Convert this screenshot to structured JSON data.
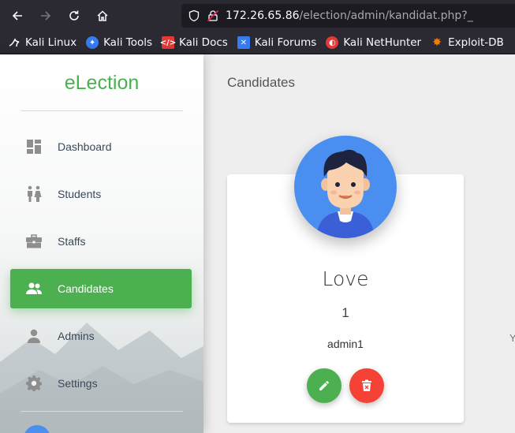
{
  "browser": {
    "url_host": "172.26.65.86",
    "url_path": "/election/admin/kandidat.php?_",
    "bookmarks": [
      {
        "label": "Kali Linux",
        "icon": "kali-dragon-icon",
        "color": "#ffffff"
      },
      {
        "label": "Kali Tools",
        "icon": "kali-tools-icon",
        "color": "#367bf0"
      },
      {
        "label": "Kali Docs",
        "icon": "kali-docs-icon",
        "color": "#e53935"
      },
      {
        "label": "Kali Forums",
        "icon": "kali-forums-icon",
        "color": "#367bf0"
      },
      {
        "label": "Kali NetHunter",
        "icon": "kali-nethunter-icon",
        "color": "#e53935"
      },
      {
        "label": "Exploit-DB",
        "icon": "exploit-db-icon",
        "color": "#f57c00"
      }
    ]
  },
  "sidebar": {
    "brand": "eLection",
    "items": [
      {
        "label": "Dashboard",
        "icon": "dashboard-icon",
        "active": false
      },
      {
        "label": "Students",
        "icon": "students-icon",
        "active": false
      },
      {
        "label": "Staffs",
        "icon": "briefcase-icon",
        "active": false
      },
      {
        "label": "Candidates",
        "icon": "people-icon",
        "active": true
      },
      {
        "label": "Admins",
        "icon": "person-icon",
        "active": false
      },
      {
        "label": "Settings",
        "icon": "gear-icon",
        "active": false
      }
    ]
  },
  "main": {
    "title": "Candidates",
    "edge_text": "Y",
    "candidate": {
      "name": "Love",
      "number": "1",
      "creator": "admin1"
    }
  },
  "colors": {
    "accent": "#4caf50",
    "danger": "#f44336",
    "avatar_bg": "#4a8ef0"
  }
}
